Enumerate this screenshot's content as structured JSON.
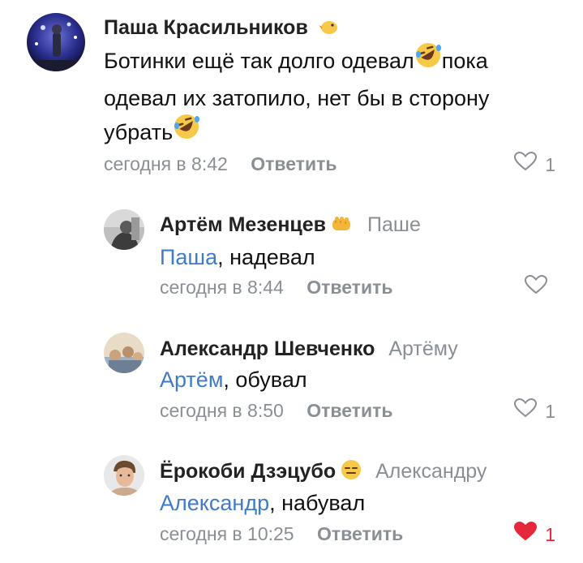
{
  "comments": [
    {
      "author": "Паша Красильников",
      "reply_to": "",
      "text_parts": [
        "Ботинки ещё так долго одевал",
        "пока",
        "одевал их затопило, нет бы в сторону",
        "убрать"
      ],
      "time": "сегодня в 8:42",
      "reply_label": "Ответить",
      "likes": "1",
      "liked": false
    },
    {
      "author": "Артём Мезенцев",
      "reply_to": "Паше",
      "mention": "Паша",
      "text": ", надевал",
      "time": "сегодня в 8:44",
      "reply_label": "Ответить",
      "likes": "",
      "liked": false
    },
    {
      "author": "Александр Шевченко",
      "reply_to": "Артёму",
      "mention": "Артём",
      "text": ", обувал",
      "time": "сегодня в 8:50",
      "reply_label": "Ответить",
      "likes": "1",
      "liked": false
    },
    {
      "author": "Ёрокоби Дзэцубо",
      "reply_to": "Александру",
      "mention": "Александр",
      "text": ", набувал",
      "time": "сегодня в 10:25",
      "reply_label": "Ответить",
      "likes": "1",
      "liked": true
    }
  ],
  "colors": {
    "mention": "#3f7bc8",
    "meta": "#8a8f96",
    "liked": "#e6283c"
  },
  "icons": [
    "heart-icon",
    "rofl-emoji-icon",
    "thumbs-badge-icon",
    "expressionless-emoji-icon",
    "chick-badge-icon"
  ]
}
